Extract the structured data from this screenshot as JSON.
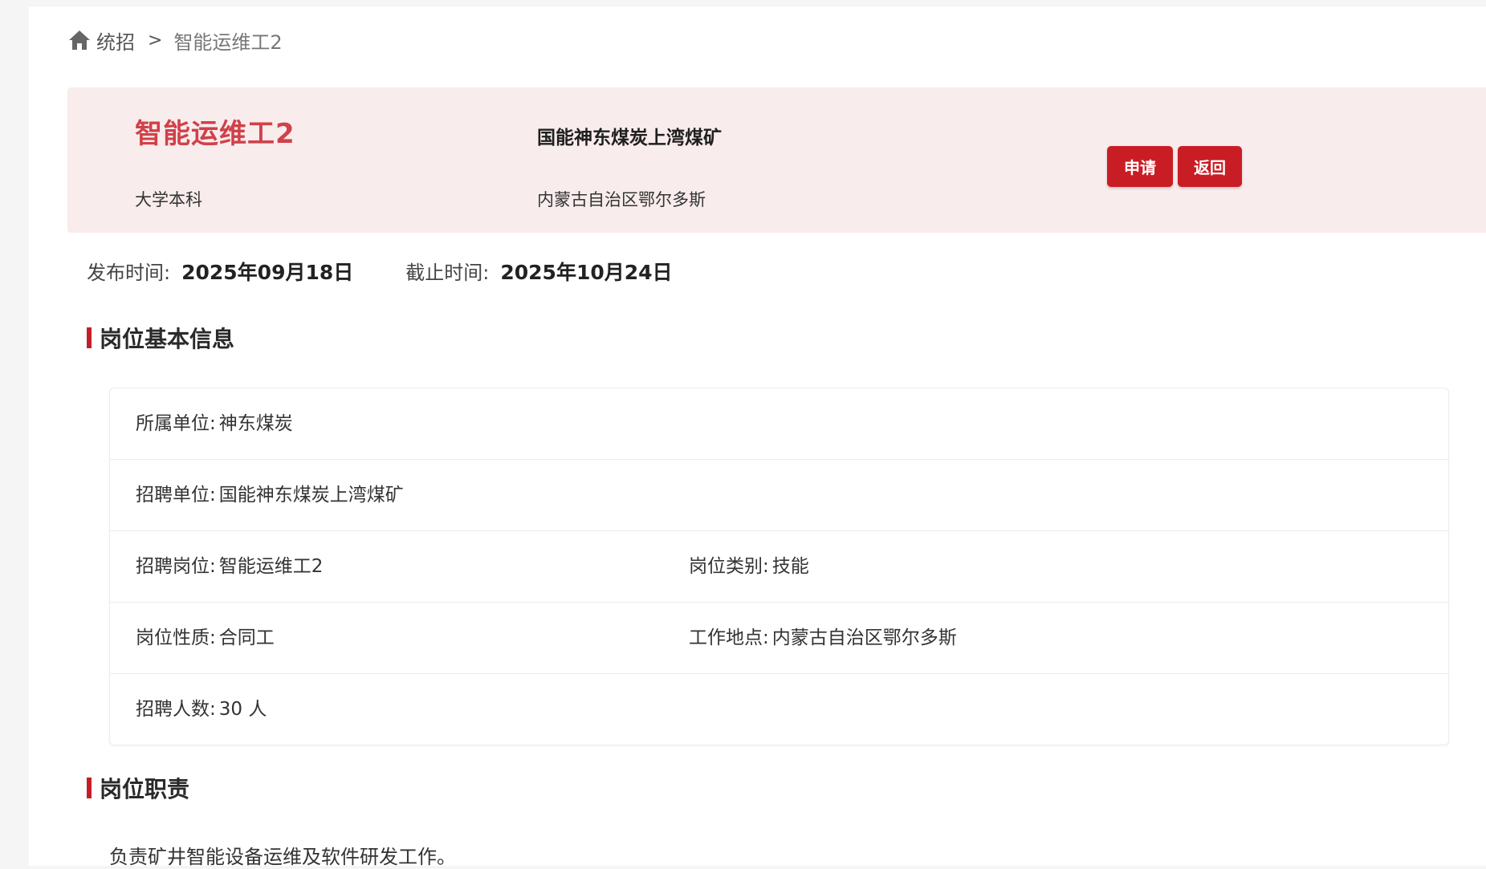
{
  "breadcrumb": {
    "home": "统招",
    "separator": ">",
    "current": "智能运维工2"
  },
  "job": {
    "title": "智能运维工2",
    "company": "国能神东煤炭上湾煤矿",
    "education": "大学本科",
    "location": "内蒙古自治区鄂尔多斯",
    "apply_label": "申请",
    "back_label": "返回"
  },
  "dates": {
    "publish_label": "发布时间:",
    "publish_value": "2025年09月18日",
    "deadline_label": "截止时间:",
    "deadline_value": "2025年10月24日"
  },
  "sections": {
    "basic_info_title": "岗位基本信息",
    "duty_title": "岗位职责",
    "duty_text": "负责矿井智能设备运维及软件研发工作。"
  },
  "info": {
    "affiliation_label": "所属单位:",
    "affiliation_value": "神东煤炭",
    "employer_label": "招聘单位:",
    "employer_value": "国能神东煤炭上湾煤矿",
    "position_label": "招聘岗位:",
    "position_value": "智能运维工2",
    "category_label": "岗位类别:",
    "category_value": "技能",
    "nature_label": "岗位性质:",
    "nature_value": "合同工",
    "workplace_label": "工作地点:",
    "workplace_value": "内蒙古自治区鄂尔多斯",
    "headcount_label": "招聘人数:",
    "headcount_value": "30 人"
  },
  "colors": {
    "accent": "#c91d25",
    "title_red": "#d0414a",
    "header_bg": "#f9ecec"
  },
  "icons": {
    "home": "home-icon"
  }
}
